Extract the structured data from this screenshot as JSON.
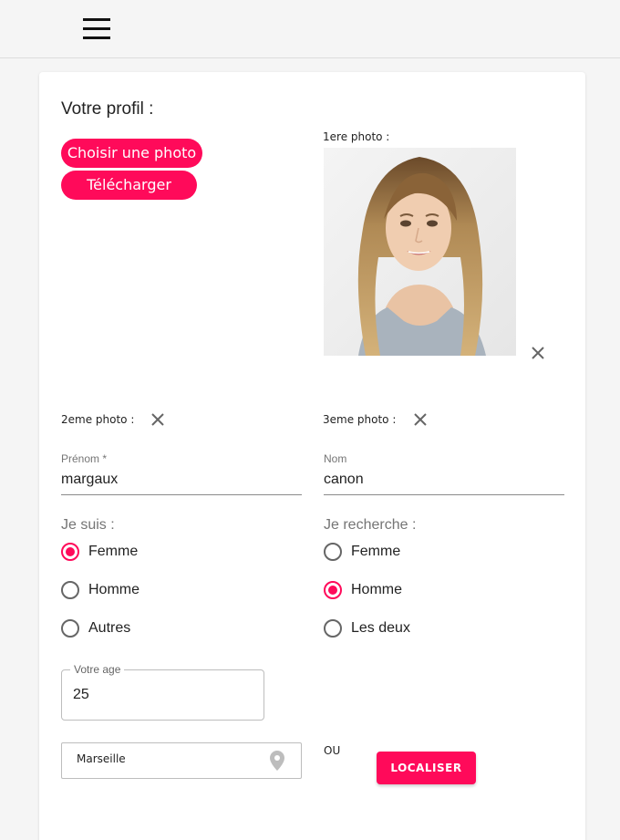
{
  "colors": {
    "accent": "#ff0a5a",
    "background": "#f5f5f5",
    "card": "#ffffff"
  },
  "topbar": {
    "menu_icon": "hamburger-menu-icon"
  },
  "profile": {
    "title": "Votre profil :",
    "choose_photo_label": "Choisir une photo",
    "upload_label": "Télécharger",
    "photo1_label": "1ere photo :",
    "photo2_label": "2eme photo :",
    "photo3_label": "3eme photo :",
    "remove_icon": "close-icon"
  },
  "form": {
    "prenom_label": "Prénom *",
    "prenom_value": "margaux",
    "nom_label": "Nom",
    "nom_value": "canon",
    "je_suis_label": "Je suis :",
    "je_suis_options": [
      {
        "label": "Femme",
        "checked": true
      },
      {
        "label": "Homme",
        "checked": false
      },
      {
        "label": "Autres",
        "checked": false
      }
    ],
    "je_recherche_label": "Je recherche :",
    "je_recherche_options": [
      {
        "label": "Femme",
        "checked": false
      },
      {
        "label": "Homme",
        "checked": true
      },
      {
        "label": "Les deux",
        "checked": false
      }
    ],
    "age_label": "Votre age",
    "age_value": "25",
    "city_value": "Marseille",
    "city_icon": "location-pin-icon",
    "ou_label": "OU",
    "localiser_label": "LOCALISER"
  }
}
